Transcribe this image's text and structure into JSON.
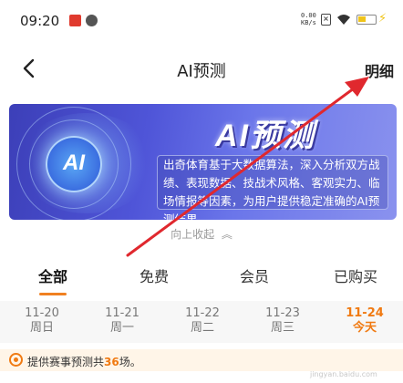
{
  "status_bar": {
    "time": "09:20",
    "net_speed_value": "0.00",
    "net_speed_unit": "KB/s",
    "battery_color": "#f0c419"
  },
  "nav": {
    "title": "AI预测",
    "detail_label": "明细"
  },
  "banner": {
    "logo_text": "AI预测",
    "circle_text": "AI",
    "description": "出奇体育基于大数据算法，深入分析双方战绩、表现数据、技战术风格、客观实力、临场情报等因素，为用户提供稳定准确的AI预测结果。",
    "gradient_start": "#3c3fb8",
    "gradient_end": "#8a92ee"
  },
  "collapse": {
    "label": "向上收起",
    "icon": "double-chevron-up-icon"
  },
  "tabs": [
    {
      "label": "全部",
      "active": true
    },
    {
      "label": "免费",
      "active": false
    },
    {
      "label": "会员",
      "active": false
    },
    {
      "label": "已购买",
      "active": false
    }
  ],
  "dates": [
    {
      "day": "11-20",
      "week": "周日",
      "active": false
    },
    {
      "day": "11-21",
      "week": "周一",
      "active": false
    },
    {
      "day": "11-22",
      "week": "周二",
      "active": false
    },
    {
      "day": "11-23",
      "week": "周三",
      "active": false
    },
    {
      "day": "11-24",
      "week": "今天",
      "active": true
    }
  ],
  "notice": {
    "prefix": "提供赛事预测共",
    "count": "36",
    "suffix": "场。"
  },
  "colors": {
    "accent": "#f07a12",
    "annotation_arrow": "#e0282e"
  },
  "watermark": "jingyan.baidu.com"
}
